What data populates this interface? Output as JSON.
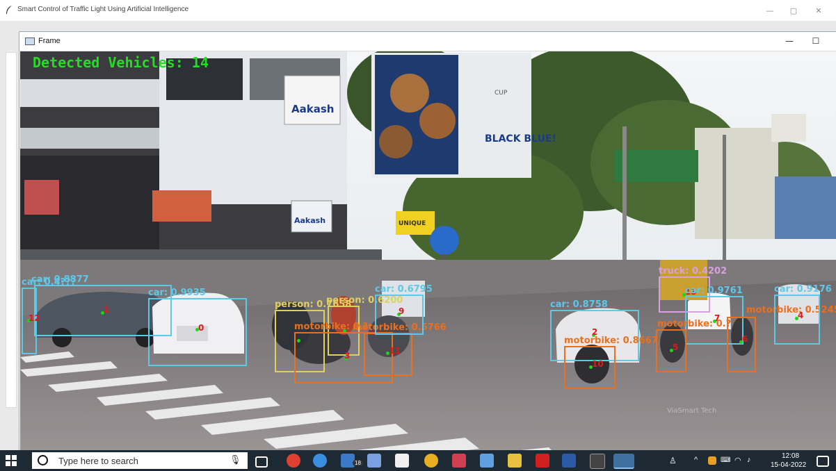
{
  "app": {
    "title": "Smart Control of Traffic Light Using Artificial Intelligence",
    "minimize": "—",
    "maximize": "▢",
    "close": "✕"
  },
  "frame": {
    "title": "Frame",
    "minimize": "—",
    "maximize": "☐",
    "overlay_text": "Detected Vehicles: 14"
  },
  "billboards": {
    "aakash": "Aakash",
    "black_blue": "BLACK BLUE!",
    "cup": "CUP",
    "unique": "UNIQUE"
  },
  "detections": [
    {
      "label": "car: 0.8877",
      "id": "1",
      "color": "#5ec8e8"
    },
    {
      "label": "car: 0.9935",
      "id": "0",
      "color": "#5ec8e8"
    },
    {
      "label": "car: 0.4???",
      "id": "12",
      "color": "#5ec8e8"
    },
    {
      "label": "person: 0.7658",
      "id": "",
      "color": "#e0d060"
    },
    {
      "label": "person: 0.6200",
      "id": "",
      "color": "#e0d060"
    },
    {
      "label": "motorbike: 0.?",
      "id": "3",
      "color": "#e87020"
    },
    {
      "label": "motorbike: 0.5766",
      "id": "11",
      "color": "#e87020"
    },
    {
      "label": "car: 0.6795",
      "id": "9",
      "color": "#5ec8e8"
    },
    {
      "label": "car: 0.8758",
      "id": "2",
      "color": "#5ec8e8"
    },
    {
      "label": "motorbike: 0.8667",
      "id": "10",
      "color": "#e87020"
    },
    {
      "label": "truck: 0.4202",
      "id": "13",
      "color": "#d8a0e0"
    },
    {
      "label": "car: 0.9761",
      "id": "7",
      "color": "#5ec8e8"
    },
    {
      "label": "motorbike: 0.?",
      "id": "5",
      "color": "#e87020"
    },
    {
      "label": "motorbike: 0.5245",
      "id": "6",
      "color": "#e87020"
    },
    {
      "label": "car: 0.9176",
      "id": "4",
      "color": "#5ec8e8"
    }
  ],
  "taskbar": {
    "search_placeholder": "Type here to search",
    "mail_badge": "18",
    "time": "12:08",
    "date": "15-04-2022"
  },
  "colors": {
    "overlay_green": "#20e020",
    "taskbar": "#1e2a33"
  }
}
